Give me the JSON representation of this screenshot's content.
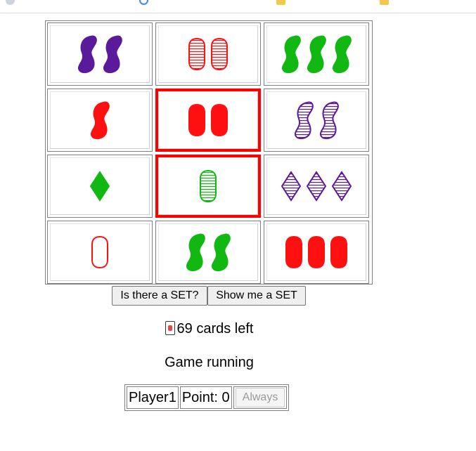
{
  "colors": {
    "purple": "#5a1a9a",
    "red": "#ff1010",
    "green": "#12b812",
    "selected_border": "#ff0000"
  },
  "board": [
    {
      "count": 2,
      "shape": "squiggle",
      "color": "purple",
      "fill": "solid",
      "selected": false
    },
    {
      "count": 2,
      "shape": "oval",
      "color": "red",
      "fill": "striped",
      "selected": false
    },
    {
      "count": 3,
      "shape": "squiggle",
      "color": "green",
      "fill": "solid",
      "selected": false
    },
    {
      "count": 1,
      "shape": "squiggle",
      "color": "red",
      "fill": "solid",
      "selected": false
    },
    {
      "count": 2,
      "shape": "oval",
      "color": "red",
      "fill": "solid",
      "selected": true
    },
    {
      "count": 2,
      "shape": "squiggle",
      "color": "purple",
      "fill": "striped",
      "selected": false
    },
    {
      "count": 1,
      "shape": "diamond",
      "color": "green",
      "fill": "solid",
      "selected": false
    },
    {
      "count": 1,
      "shape": "oval",
      "color": "green",
      "fill": "striped",
      "selected": true
    },
    {
      "count": 3,
      "shape": "diamond",
      "color": "purple",
      "fill": "striped",
      "selected": false
    },
    {
      "count": 1,
      "shape": "oval",
      "color": "red",
      "fill": "empty",
      "selected": false
    },
    {
      "count": 2,
      "shape": "squiggle",
      "color": "green",
      "fill": "solid",
      "selected": false
    },
    {
      "count": 3,
      "shape": "oval",
      "color": "red",
      "fill": "solid",
      "selected": false
    }
  ],
  "controls": {
    "is_set_label": "Is there a SET?",
    "show_set_label": "Show me a SET"
  },
  "status": {
    "cards_icon": "playing-card-icon",
    "cards_left": "69 cards left",
    "game_state": "Game running"
  },
  "scoreboard": {
    "player": "Player1",
    "points": "Point: 0",
    "always_label": "Always"
  }
}
